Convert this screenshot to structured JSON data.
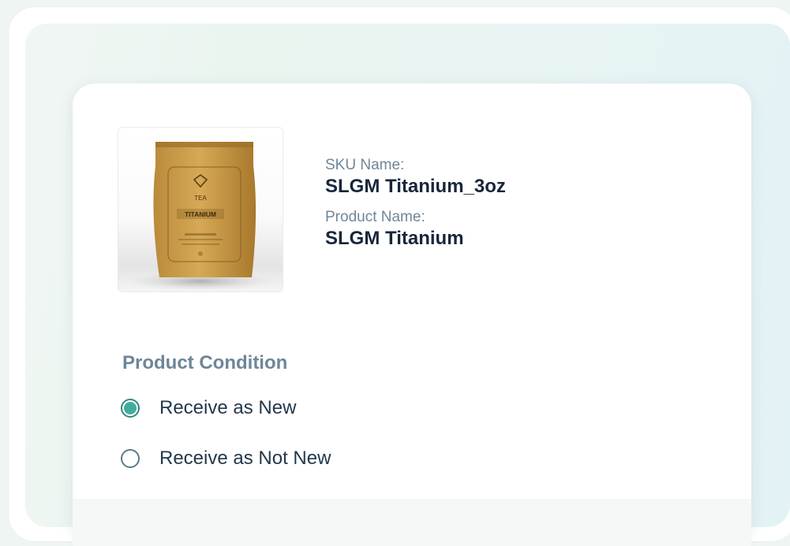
{
  "product": {
    "image_icon": "tea-pouch-image",
    "image_brand": "TEA",
    "image_label": "TITANIUM",
    "sku_label": "SKU Name:",
    "sku_value": "SLGM Titanium_3oz",
    "name_label": "Product Name:",
    "name_value": "SLGM Titanium"
  },
  "condition": {
    "title": "Product Condition",
    "options": [
      {
        "label": "Receive as New",
        "selected": true
      },
      {
        "label": "Receive as Not New",
        "selected": false
      }
    ]
  },
  "colors": {
    "accent": "#3fae9d",
    "label": "#6f8798",
    "heading": "#17263a"
  }
}
